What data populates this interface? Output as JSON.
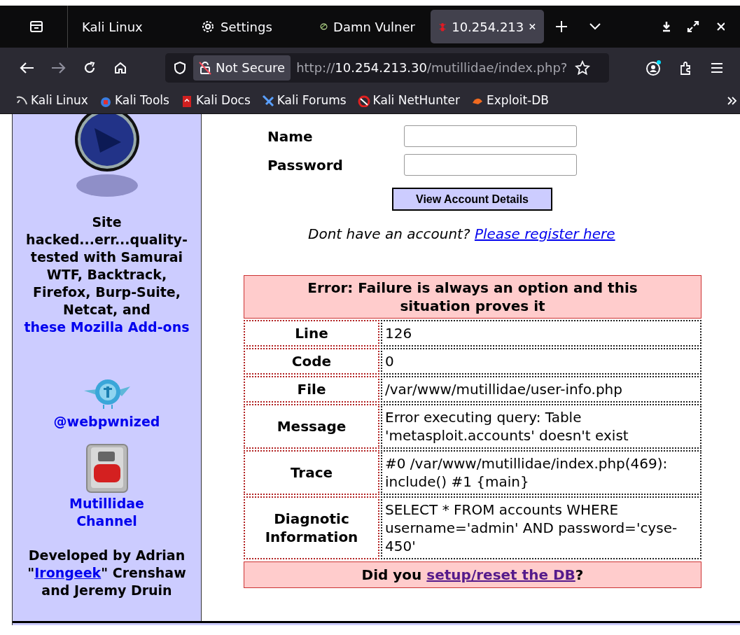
{
  "tabs": [
    {
      "label": "Kali Linux",
      "selected": false,
      "kind": "plain"
    },
    {
      "label": "Settings",
      "selected": false,
      "kind": "gear"
    },
    {
      "label": "Damn Vulner",
      "selected": false,
      "kind": "globe"
    },
    {
      "label": "10.254.213",
      "selected": true,
      "kind": "bug"
    }
  ],
  "address_bar": {
    "security": "Not Secure",
    "url_scheme": "http://",
    "url_host": "10.254.213.30",
    "url_path": "/mutillidae/index.php?"
  },
  "bookmarks": [
    {
      "label": "Kali Linux",
      "kind": "dragon"
    },
    {
      "label": "Kali Tools",
      "kind": "tools"
    },
    {
      "label": "Kali Docs",
      "kind": "docs"
    },
    {
      "label": "Kali Forums",
      "kind": "forums"
    },
    {
      "label": "Kali NetHunter",
      "kind": "nethunter"
    },
    {
      "label": "Exploit-DB",
      "kind": "exploit"
    }
  ],
  "sidebar": {
    "credits": "Site hacked...err...quality-tested with Samurai WTF, Backtrack, Firefox, Burp-Suite, Netcat, and ",
    "credits_link": "these Mozilla Add-ons",
    "twitter": "@webpwnized",
    "youtube": "Mutillidae Channel",
    "dev_before": "Developed by Adrian \"",
    "dev_link": "Irongeek",
    "dev_after": "\" Crenshaw and Jeremy Druin"
  },
  "form": {
    "fields": [
      {
        "label": "Name"
      },
      {
        "label": "Password"
      }
    ],
    "button": "View Account Details",
    "register_text": "Dont have an account?",
    "register_link": "Please register here"
  },
  "error": {
    "title": "Error: Failure is always an option and this situation proves it",
    "rows": [
      {
        "label": "Line",
        "value": "126"
      },
      {
        "label": "Code",
        "value": "0"
      },
      {
        "label": "File",
        "value": "/var/www/mutillidae/user-info.php"
      },
      {
        "label": "Message",
        "value": "Error executing query: Table 'metasploit.accounts' doesn't exist"
      },
      {
        "label": "Trace",
        "value": "#0 /var/www/mutillidae/index.php(469): include() #1 {main}"
      },
      {
        "label": "Diagnotic Information",
        "value": "SELECT * FROM accounts WHERE username='admin' AND password='cyse-450'"
      }
    ],
    "footer_before": "Did you ",
    "footer_link": "setup/reset the DB",
    "footer_after": "?"
  }
}
